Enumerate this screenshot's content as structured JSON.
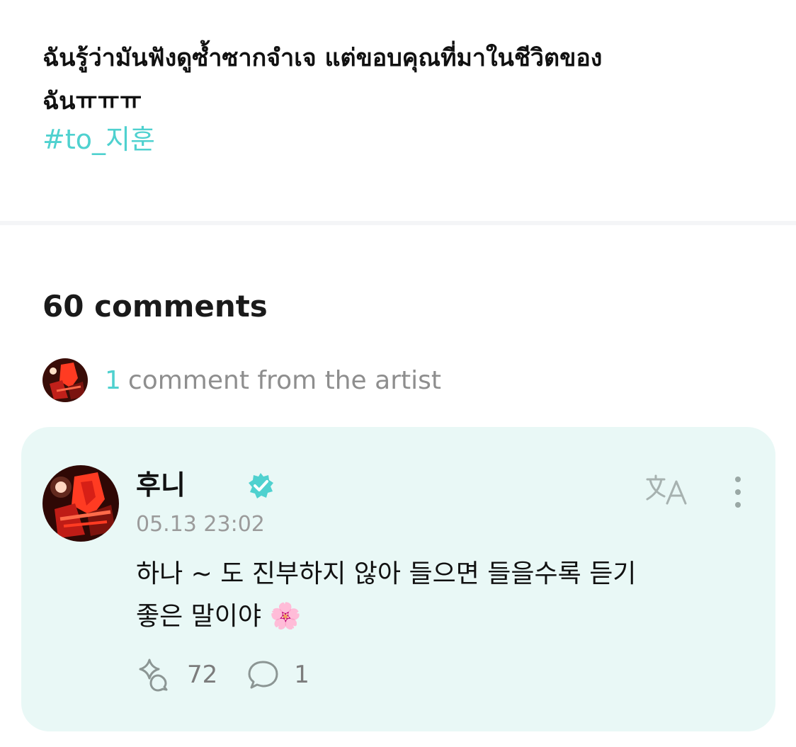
{
  "post": {
    "text_line1": "ฉันรู้ว่ามันฟังดูซ้ำซากจำเจ แต่ขอบคุณที่มาในชีวิตของ",
    "text_line2": "ฉันㅠㅠㅠ",
    "hashtag": "#to_지훈"
  },
  "comments": {
    "count_label": "60 comments",
    "artist_count": "1",
    "artist_label": "comment from the artist"
  },
  "artist_comment": {
    "author": "후니",
    "timestamp": "05.13 23:02",
    "body_line1": "하나 ~ 도 진부하지 않아 들으면 들을수록 듣기",
    "body_line2": "좋은 말이야 🌸",
    "likes": "72",
    "replies": "1"
  },
  "icons": {
    "verified": "verified-badge-icon",
    "translate": "translate-icon",
    "more": "more-vertical-icon",
    "like": "sparkle-like-icon",
    "reply": "speech-bubble-icon"
  },
  "colors": {
    "accent": "#4fd1cf",
    "card_background": "#e9f8f6",
    "muted_text": "#8e8e8e"
  }
}
